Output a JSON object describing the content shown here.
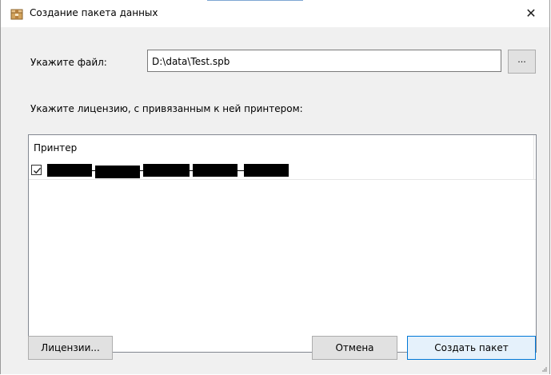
{
  "window": {
    "title": "Создание пакета данных",
    "close_glyph": "✕"
  },
  "file": {
    "label": "Укажите файл:",
    "value": "D:\\data\\Test.spb",
    "browse_label": "..."
  },
  "license": {
    "label": "Укажите лицензию, с привязанным к ней принтером:",
    "column_header": "Принтер",
    "rows": [
      {
        "checked": true,
        "text_redacted": true
      }
    ]
  },
  "buttons": {
    "licenses": "Лицензии...",
    "cancel": "Отмена",
    "create": "Создать пакет"
  },
  "icons": {
    "title_icon": "package-icon",
    "close_icon": "close-icon",
    "checkbox_icon": "checkmark-icon"
  },
  "colors": {
    "accent_border": "#0078d7",
    "dialog_bg": "#f0f0f0",
    "package_icon": "#d2a25c"
  }
}
